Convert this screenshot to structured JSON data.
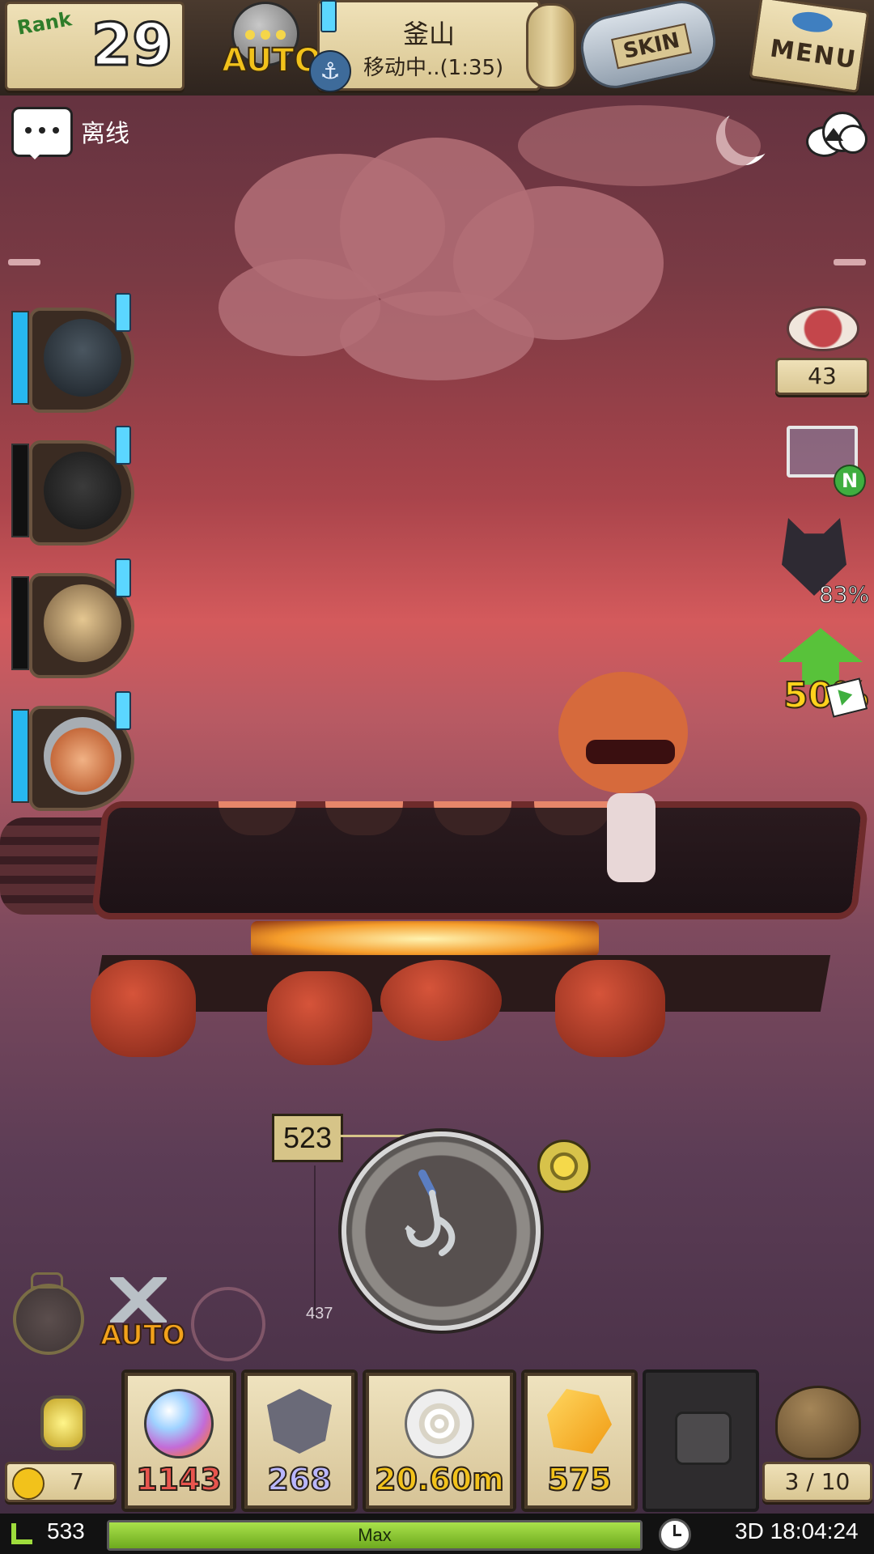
{
  "topbar": {
    "rank_label": "Rank",
    "rank_value": "29",
    "auto_label": "AUTO",
    "location_name": "釜山",
    "location_status": "移动中..(1:35)",
    "skin_label": "SKIN",
    "menu_label": "MENU"
  },
  "chat": {
    "status_label": "离线"
  },
  "right_panel": {
    "meat_count": "43",
    "cart_badge": "N",
    "mask_percent": "83%",
    "boost_percent": "50%"
  },
  "fishing": {
    "line_counter": "523",
    "depth_label": "437"
  },
  "tools": {
    "auto_label": "AUTO"
  },
  "items": {
    "lantern_count": "7",
    "slots": [
      {
        "name": "pearl",
        "value": "1143",
        "color": "#e8554e"
      },
      {
        "name": "shield-badge",
        "value": "268",
        "color": "#b9b6ff"
      },
      {
        "name": "shell",
        "value": "20.60m",
        "color": "#f2c21b"
      },
      {
        "name": "gold-ore",
        "value": "575",
        "color": "#f2c21b"
      }
    ],
    "bag_count": "3 / 10"
  },
  "status_bar": {
    "level": "533",
    "exp_label": "Max",
    "exp_fraction": 1.0,
    "time": "3D 18:04:24"
  }
}
